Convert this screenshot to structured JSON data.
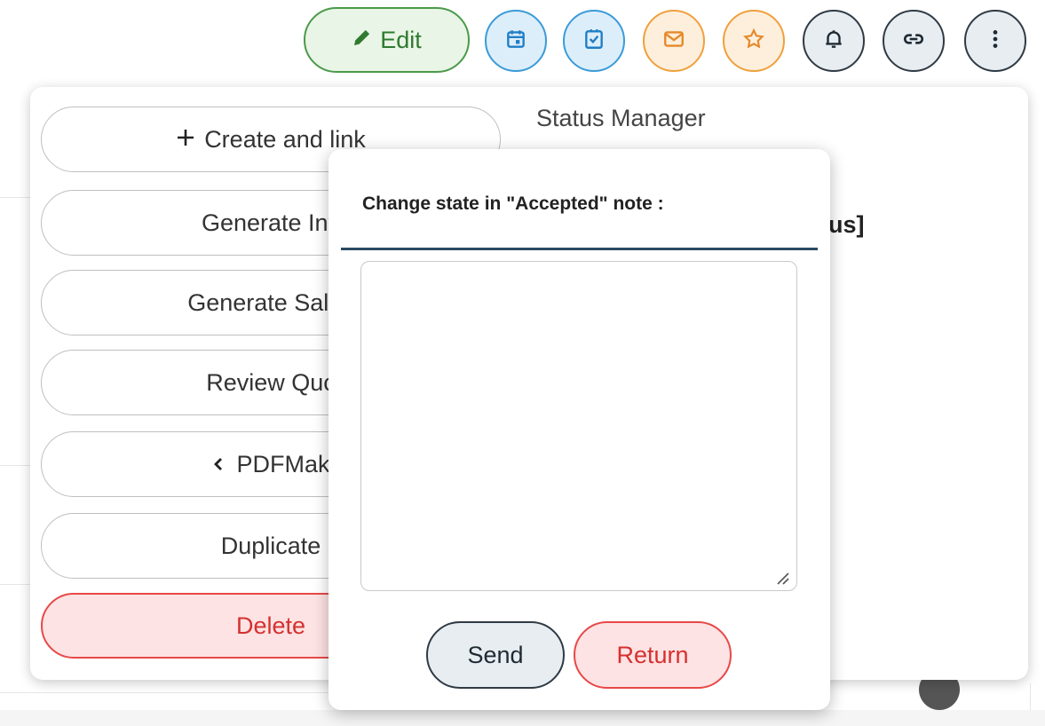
{
  "toolbar": {
    "edit_label": "Edit",
    "icons": [
      "calendar-icon",
      "task-check-icon",
      "mail-icon",
      "star-icon",
      "bell-icon",
      "link-icon",
      "more-vertical-icon"
    ]
  },
  "menu": {
    "items": [
      {
        "label": "Create and link",
        "icon": "plus-icon"
      },
      {
        "label": "Generate Inv"
      },
      {
        "label": "Generate Sales"
      },
      {
        "label": "Review Quc"
      },
      {
        "label": "PDFMak",
        "icon": "chevron-left-icon"
      },
      {
        "label": "Duplicate"
      },
      {
        "label": "Delete"
      }
    ]
  },
  "right_panel": {
    "title": "Status Manager",
    "fragment": "tus]"
  },
  "modal": {
    "title": "Change state in \"Accepted\" note :",
    "note_value": "",
    "send_label": "Send",
    "return_label": "Return"
  },
  "colors": {
    "edit": "#4a9a4a",
    "blue": "#3a9bd8",
    "orange": "#f0a03c",
    "dark": "#2f3a44",
    "danger": "#e84848"
  }
}
